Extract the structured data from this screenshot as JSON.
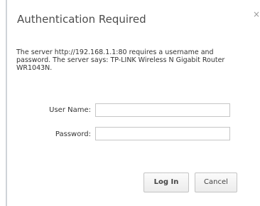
{
  "dialog": {
    "title": "Authentication Required",
    "close_glyph": "×",
    "message": "The server http://192.168.1.1:80 requires a username and password. The server says: TP-LINK Wireless N Gigabit Router WR1043N.",
    "username": {
      "label": "User Name:",
      "value": ""
    },
    "password": {
      "label": "Password:",
      "value": ""
    },
    "buttons": {
      "login": "Log In",
      "cancel": "Cancel"
    }
  }
}
